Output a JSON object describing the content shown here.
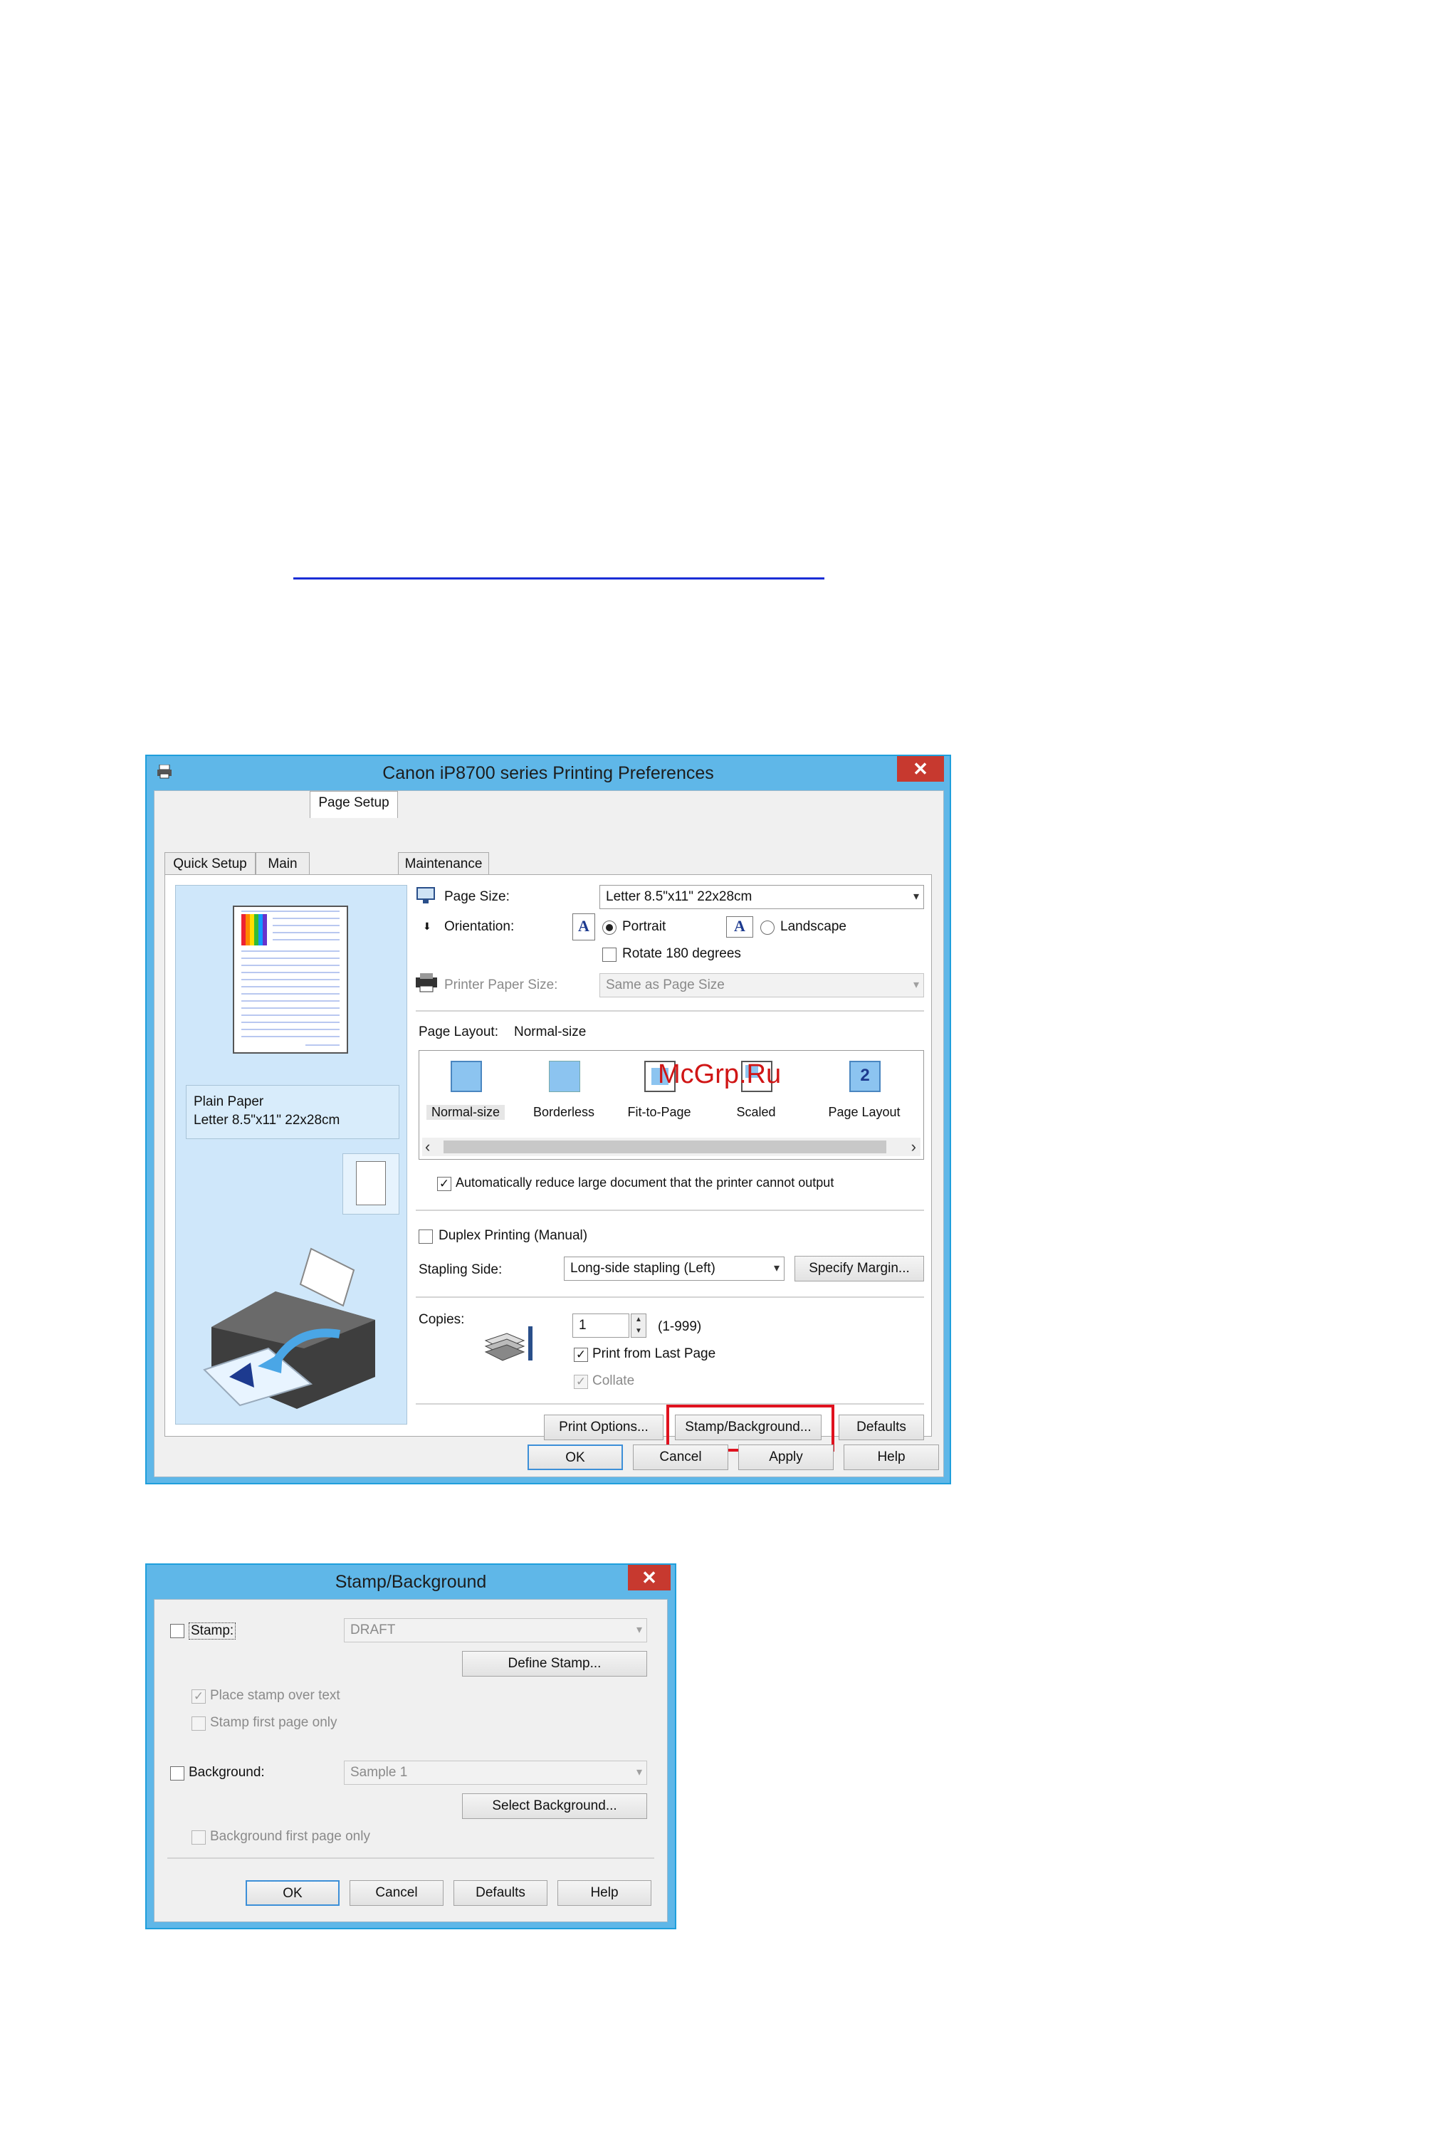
{
  "watermark": "McGrp.Ru",
  "colors": {
    "accent": "#1f9fdc",
    "close": "#c7392f",
    "highlight": "#e0121f",
    "link": "#1a2ed6"
  },
  "prefs": {
    "title": "Canon iP8700 series Printing Preferences",
    "close_glyph": "✕",
    "tabs": [
      "Quick Setup",
      "Main",
      "Page Setup",
      "Maintenance"
    ],
    "active_tab": "Page Setup",
    "preview": {
      "media": "Plain Paper",
      "size": "Letter 8.5\"x11\" 22x28cm"
    },
    "page_size": {
      "label": "Page Size:",
      "value": "Letter 8.5\"x11\" 22x28cm"
    },
    "orientation": {
      "label": "Orientation:",
      "portrait": "Portrait",
      "landscape": "Landscape",
      "rotate": "Rotate 180 degrees",
      "selected": "Portrait",
      "rotate_checked": false
    },
    "printer_paper_size": {
      "label": "Printer Paper Size:",
      "value": "Same as Page Size"
    },
    "page_layout": {
      "label": "Page Layout:",
      "value": "Normal-size",
      "items": [
        "Normal-size",
        "Borderless",
        "Fit-to-Page",
        "Scaled",
        "Page Layout"
      ]
    },
    "auto_reduce": {
      "label": "Automatically reduce large document that the printer cannot output",
      "checked": true
    },
    "duplex": {
      "label": "Duplex Printing (Manual)",
      "checked": false
    },
    "stapling": {
      "label": "Stapling Side:",
      "value": "Long-side stapling (Left)",
      "margin_button": "Specify Margin..."
    },
    "copies": {
      "label": "Copies:",
      "value": "1",
      "range": "(1-999)",
      "from_last": "Print from Last Page",
      "from_last_checked": true,
      "collate": "Collate",
      "collate_checked": true
    },
    "buttons": {
      "print_options": "Print Options...",
      "stamp_background": "Stamp/Background...",
      "defaults": "Defaults"
    },
    "footer": {
      "ok": "OK",
      "cancel": "Cancel",
      "apply": "Apply",
      "help": "Help"
    }
  },
  "stamp": {
    "title": "Stamp/Background",
    "close_glyph": "✕",
    "stamp_label": "Stamp:",
    "stamp_checked": false,
    "stamp_value": "DRAFT",
    "define_button": "Define Stamp...",
    "place_over_text": "Place stamp over text",
    "place_over_text_checked": true,
    "first_page_only": "Stamp first page only",
    "background_label": "Background:",
    "background_checked": false,
    "background_value": "Sample 1",
    "select_button": "Select Background...",
    "background_first_page": "Background first page only",
    "footer": {
      "ok": "OK",
      "cancel": "Cancel",
      "defaults": "Defaults",
      "help": "Help"
    }
  }
}
